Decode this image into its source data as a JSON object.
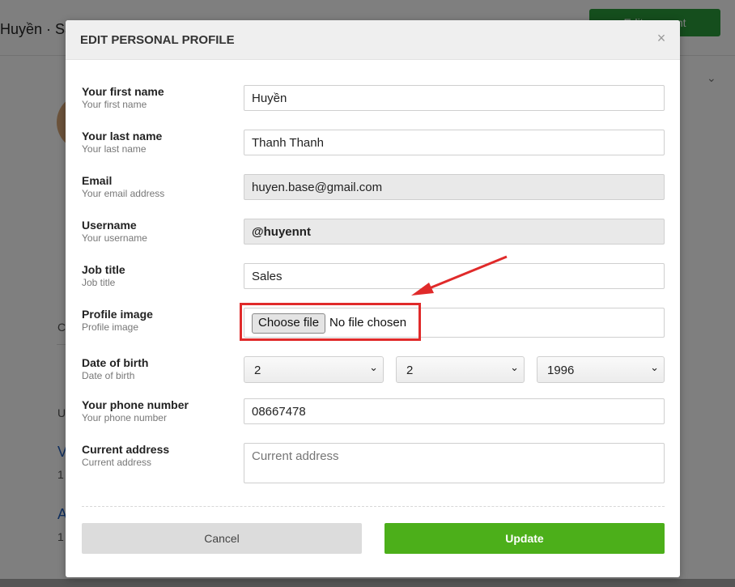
{
  "background": {
    "title": "Huyền · Sa",
    "edit_button": "Edit account",
    "letters": [
      "C",
      "U"
    ],
    "links": [
      "V",
      "A"
    ],
    "small_nums": [
      "1",
      "1"
    ]
  },
  "modal": {
    "title": "EDIT PERSONAL PROFILE",
    "close": "×",
    "fields": {
      "first_name": {
        "label": "Your first name",
        "sub": "Your first name",
        "value": "Huyền"
      },
      "last_name": {
        "label": "Your last name",
        "sub": "Your last name",
        "value": "Thanh Thanh"
      },
      "email": {
        "label": "Email",
        "sub": "Your email address",
        "value": "huyen.base@gmail.com"
      },
      "username": {
        "label": "Username",
        "sub": "Your username",
        "value": "@huyennt"
      },
      "job_title": {
        "label": "Job title",
        "sub": "Job title",
        "value": "Sales"
      },
      "profile_image": {
        "label": "Profile image",
        "sub": "Profile image",
        "button": "Choose file",
        "status": "No file chosen"
      },
      "dob": {
        "label": "Date of birth",
        "sub": "Date of birth",
        "day": "2",
        "month": "2",
        "year": "1996"
      },
      "phone": {
        "label": "Your phone number",
        "sub": "Your phone number",
        "value": "08667478"
      },
      "address": {
        "label": "Current address",
        "sub": "Current address",
        "placeholder": "Current address"
      }
    },
    "cancel": "Cancel",
    "update": "Update"
  },
  "colors": {
    "update": "#4caf1a",
    "annotation": "#e02a2a"
  }
}
